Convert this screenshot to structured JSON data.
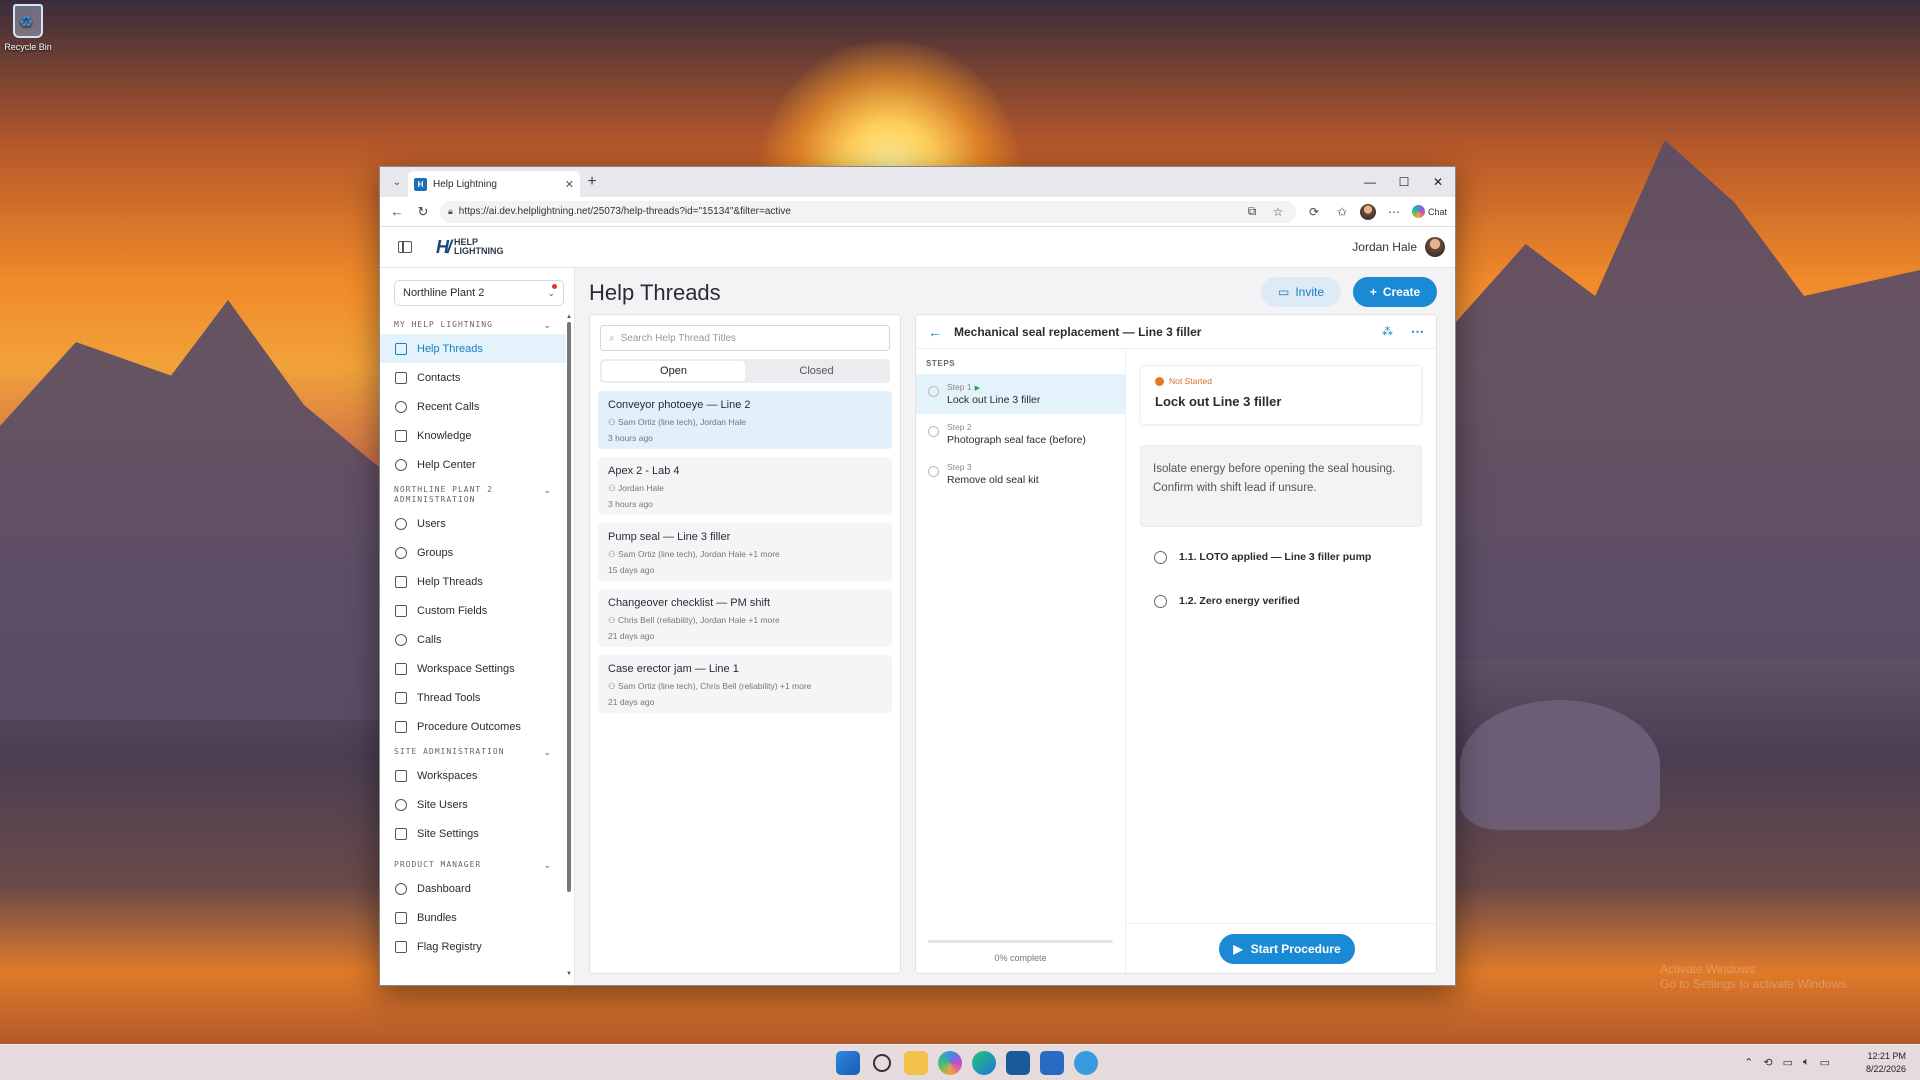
{
  "desktop": {
    "recycle_label": "Recycle Bin",
    "watermark_line1": "Activate Windows",
    "watermark_line2": "Go to Settings to activate Windows."
  },
  "browser": {
    "tab_title": "Help Lightning",
    "url": "https://ai.dev.helplightning.net/25073/help-threads?id=\"15134\"&filter=active",
    "chat_label": "Chat"
  },
  "header": {
    "logo_line1": "HELP",
    "logo_line2": "LIGHTNING",
    "user_name": "Jordan Hale"
  },
  "sidebar": {
    "workspace": "Northline Plant 2",
    "sections": {
      "my": "MY HELP LIGHTNING",
      "admin_line1": "NORTHLINE PLANT 2",
      "admin_line2": "ADMINISTRATION",
      "site": "SITE ADMINISTRATION",
      "product": "PRODUCT MANAGER"
    },
    "items": {
      "help_threads": "Help Threads",
      "contacts": "Contacts",
      "recent_calls": "Recent Calls",
      "knowledge": "Knowledge",
      "help_center": "Help Center",
      "users": "Users",
      "groups": "Groups",
      "admin_help_threads": "Help Threads",
      "custom_fields": "Custom Fields",
      "calls": "Calls",
      "workspace_settings": "Workspace Settings",
      "thread_tools": "Thread Tools",
      "procedure_outcomes": "Procedure Outcomes",
      "workspaces": "Workspaces",
      "site_users": "Site Users",
      "site_settings": "Site Settings",
      "dashboard": "Dashboard",
      "bundles": "Bundles",
      "flag_registry": "Flag Registry"
    }
  },
  "main": {
    "title": "Help Threads",
    "invite": "Invite",
    "create": "Create",
    "search_placeholder": "Search Help Thread Titles",
    "tab_open": "Open",
    "tab_closed": "Closed",
    "threads": [
      {
        "title": "Conveyor photoeye — Line 2",
        "people": "Sam Ortiz (line tech), Jordan Hale",
        "age": "3 hours ago"
      },
      {
        "title": "Apex 2 - Lab 4",
        "people": "Jordan Hale",
        "age": "3 hours ago"
      },
      {
        "title": "Pump seal — Line 3 filler",
        "people": "Sam Ortiz (line tech), Jordan Hale +1 more",
        "age": "15 days ago"
      },
      {
        "title": "Changeover checklist — PM shift",
        "people": "Chris Bell (reliability), Jordan Hale +1 more",
        "age": "21 days ago"
      },
      {
        "title": "Case erector jam — Line 1",
        "people": "Sam Ortiz (line tech), Chris Bell (reliability) +1 more",
        "age": "21 days ago"
      }
    ]
  },
  "detail": {
    "title": "Mechanical seal replacement — Line 3 filler",
    "steps_label": "STEPS",
    "steps": [
      {
        "num": "Step 1",
        "name": "Lock out Line 3 filler"
      },
      {
        "num": "Step 2",
        "name": "Photograph seal face (before)"
      },
      {
        "num": "Step 3",
        "name": "Remove old seal kit"
      }
    ],
    "progress": 0,
    "progress_label": "0% complete",
    "status": "Not Started",
    "step_heading": "Lock out Line 3 filler",
    "instruction": "Isolate energy before opening the seal housing. Confirm with shift lead if unsure.",
    "substeps": [
      "1.1. LOTO applied — Line 3 filler pump",
      "1.2. Zero energy verified"
    ],
    "start_button": "Start Procedure"
  },
  "taskbar": {
    "time": "12:21 PM",
    "date": "8/22/2026"
  }
}
